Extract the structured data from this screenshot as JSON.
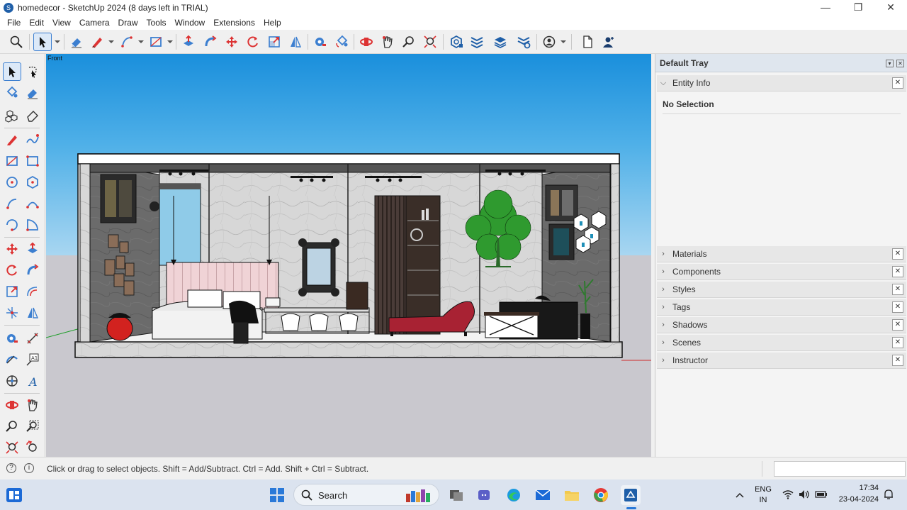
{
  "window": {
    "title": "homedecor - SketchUp 2024 (8 days left in TRIAL)",
    "minimize": "—",
    "maximize": "❐",
    "close": "✕"
  },
  "menu": [
    "File",
    "Edit",
    "View",
    "Camera",
    "Draw",
    "Tools",
    "Window",
    "Extensions",
    "Help"
  ],
  "viewport": {
    "view_label": "Front",
    "sky_color": "#1a8fdc",
    "ground_color": "#c9c8ce"
  },
  "tray": {
    "title": "Default Tray",
    "entity_info": {
      "label": "Entity Info",
      "selection": "No Selection"
    },
    "panels": [
      "Materials",
      "Components",
      "Styles",
      "Tags",
      "Shadows",
      "Scenes",
      "Instructor"
    ]
  },
  "status": {
    "text": "Click or drag to select objects. Shift = Add/Subtract. Ctrl = Add. Shift + Ctrl = Subtract.",
    "measurements_value": ""
  },
  "taskbar": {
    "search_label": "Search",
    "lang_top": "ENG",
    "lang_bottom": "IN",
    "time": "17:34",
    "date": "23-04-2024"
  },
  "accent_color": "#3c7fd0"
}
